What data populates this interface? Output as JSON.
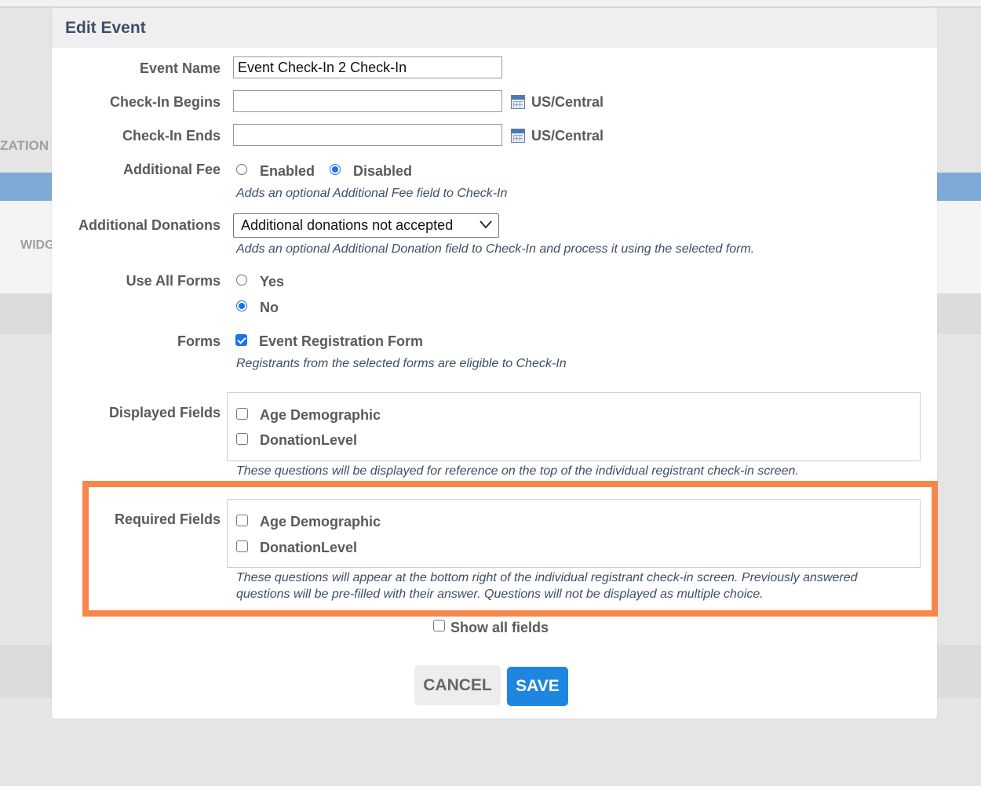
{
  "background": {
    "partial_label_1": "ZATION",
    "partial_label_2": "WIDG"
  },
  "modal": {
    "title": "Edit Event",
    "event_name": {
      "label": "Event Name",
      "value": "Event Check-In 2 Check-In"
    },
    "checkin_begins": {
      "label": "Check-In Begins",
      "value": "",
      "timezone": "US/Central"
    },
    "checkin_ends": {
      "label": "Check-In Ends",
      "value": "",
      "timezone": "US/Central"
    },
    "additional_fee": {
      "label": "Additional Fee",
      "options": [
        "Enabled",
        "Disabled"
      ],
      "selected": "Disabled",
      "hint": "Adds an optional Additional Fee field to Check-In"
    },
    "additional_donations": {
      "label": "Additional Donations",
      "selected": "Additional donations not accepted",
      "hint": "Adds an optional Additional Donation field to Check-In and process it using the selected form."
    },
    "use_all_forms": {
      "label": "Use All Forms",
      "options": [
        "Yes",
        "No"
      ],
      "selected": "No"
    },
    "forms": {
      "label": "Forms",
      "items": [
        {
          "label": "Event Registration Form",
          "checked": true
        }
      ],
      "hint": "Registrants from the selected forms are eligible to Check-In"
    },
    "displayed_fields": {
      "label": "Displayed Fields",
      "items": [
        "Age Demographic",
        "DonationLevel"
      ],
      "hint": "These questions will be displayed for reference on the top of the individual registrant check-in screen."
    },
    "required_fields": {
      "label": "Required Fields",
      "items": [
        "Age Demographic",
        "DonationLevel"
      ],
      "hint_line1": "These questions will appear at the bottom right of the individual registrant check-in screen. Previously answered",
      "hint_line2": "questions will be pre-filled with their answer. Questions will not be displayed as multiple choice."
    },
    "show_all_fields": {
      "label": "Show all fields",
      "checked": false
    },
    "buttons": {
      "cancel": "CANCEL",
      "save": "SAVE"
    }
  },
  "colors": {
    "accent": "#1e86e0",
    "highlight": "#f5874a",
    "title": "#3d4f66"
  },
  "icons": [
    "calendar-icon",
    "chevron-down-icon"
  ]
}
